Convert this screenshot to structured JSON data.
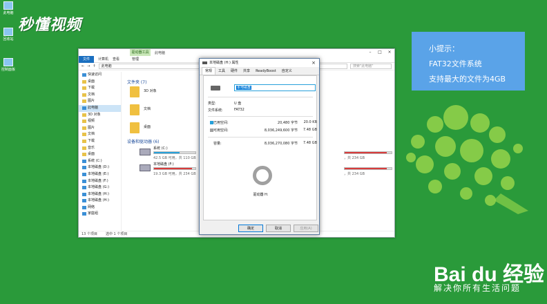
{
  "watermark": "秒懂视频",
  "desktop": [
    "此电脑",
    "回收站",
    "控制面板"
  ],
  "explorer": {
    "context_tab": "驱动器工具",
    "title": "此电脑",
    "ribbon": {
      "file": "文件",
      "tabs": [
        "计算机",
        "查看",
        "管理"
      ]
    },
    "address": "此电脑",
    "search_placeholder": "搜索\"此电脑\"",
    "nav": [
      "快速访问",
      "桌面",
      "下载",
      "文档",
      "图片",
      "此电脑",
      "3D 对象",
      "视频",
      "图片",
      "文档",
      "下载",
      "音乐",
      "桌面",
      "系统 (C:)",
      "本地磁盘 (D:)",
      "本地磁盘 (E:)",
      "本地磁盘 (F:)",
      "本地磁盘 (G:)",
      "本地磁盘 (H:)",
      "本地磁盘 (H:)",
      "网络",
      "家庭组"
    ],
    "folders_header": "文件夹 (7)",
    "folders": [
      "3D 对象",
      "文档",
      "桌面"
    ],
    "drives_header": "设备和驱动器 (6)",
    "drives": [
      {
        "name": "系统 (C:)",
        "free": "42.5 GB 可用，共 110 GB",
        "usage": 0.61,
        "full": false
      },
      {
        "name": "本地磁盘 (F:)",
        "free": "19.3 GB 可用，共 234 GB",
        "usage": 0.92,
        "full": true
      }
    ],
    "right_drives": [
      {
        "free": "，共 234 GB",
        "usage": 0.9,
        "full": true
      },
      {
        "free": "，共 234 GB",
        "usage": 0.9,
        "full": true
      }
    ],
    "status": [
      "13 个项目",
      "选中 1 个项目"
    ],
    "colors": {
      "accent": "#26a0da",
      "full": "#d83b3b",
      "ribbon": "#1a6fc0"
    }
  },
  "dialog": {
    "title": "本地磁盘 (H:) 属性",
    "tabs": [
      "常规",
      "工具",
      "硬件",
      "共享",
      "ReadyBoost",
      "自定义"
    ],
    "name": "本地磁盘",
    "type_label": "类型:",
    "type_value": "U 盘",
    "fs_label": "文件系统:",
    "fs_value": "FAT32",
    "used_label": "已用空间:",
    "used_bytes": "20,480 字节",
    "used_size": "20.0 KB",
    "free_label": "可用空间:",
    "free_bytes": "8,036,249,600 字节",
    "free_size": "7.48 GB",
    "cap_label": "容量:",
    "cap_bytes": "8,036,270,080 字节",
    "cap_size": "7.48 GB",
    "drive_label": "驱动器 H:",
    "buttons": {
      "ok": "确定",
      "cancel": "取消",
      "apply": "应用(A)"
    },
    "colors": {
      "used": "#26a0da",
      "free": "#a0a0a0"
    }
  },
  "tip": {
    "title": "小提示：",
    "line1": "FAT32文件系统",
    "line2": "支持最大的文件为4GB"
  },
  "brand": {
    "logo": "Bai du 经验",
    "slogan": "解决你所有生活问题"
  }
}
